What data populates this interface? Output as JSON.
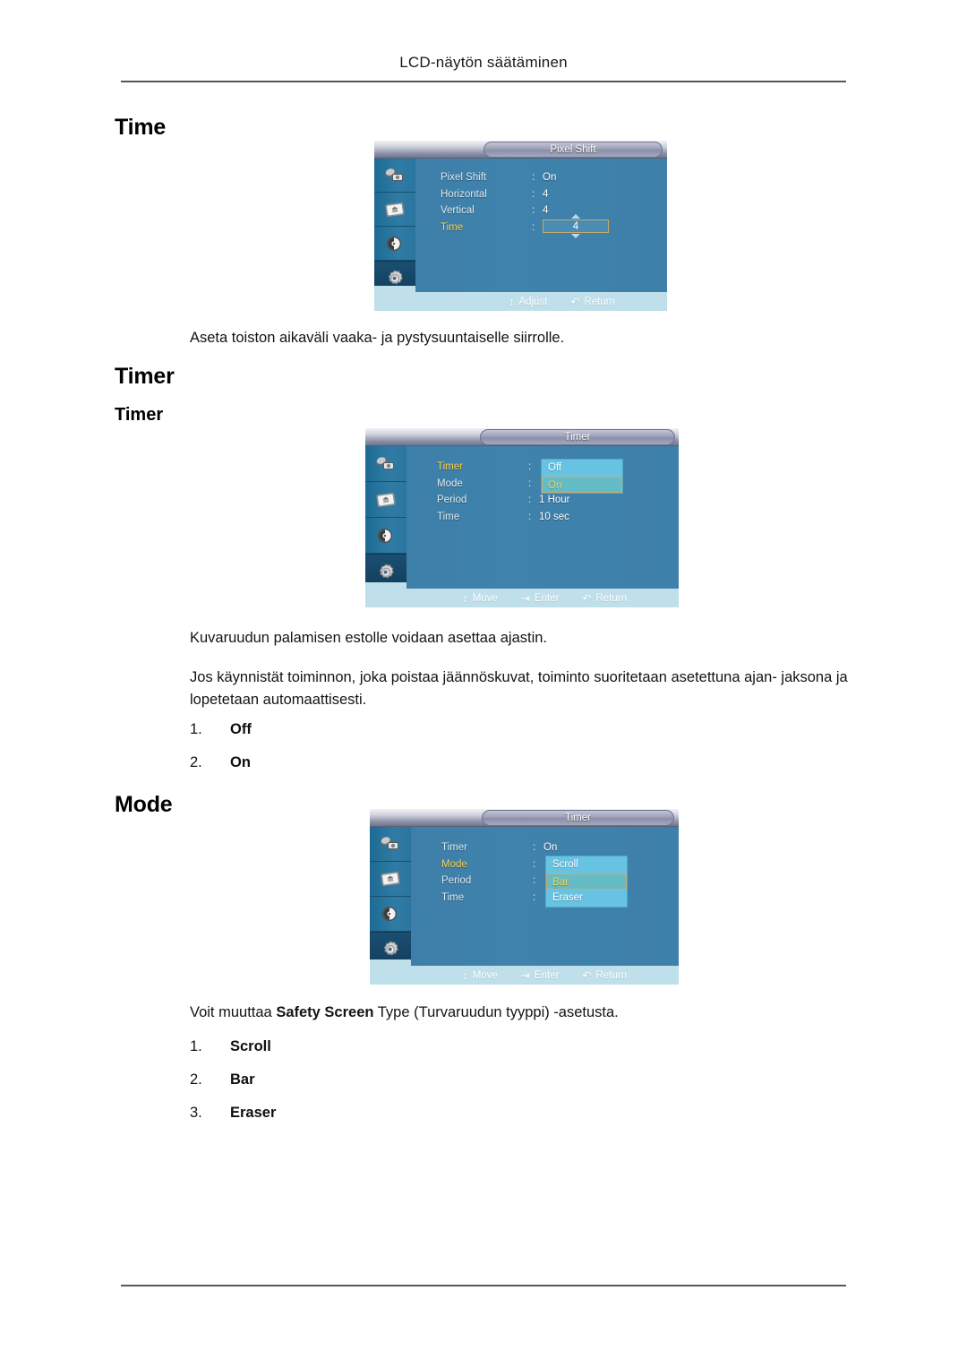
{
  "page": {
    "header_title": "LCD-näytön säätäminen"
  },
  "sections": [
    {
      "heading": "Time",
      "caption": "Aseta toiston aikaväli vaaka- ja pystysuuntaiselle siirrolle."
    },
    {
      "heading": "Timer",
      "subheading": "Timer",
      "caption1": "Kuvaruudun palamisen estolle voidaan asettaa ajastin.",
      "caption2_a": "Jos käynnistät toiminnon, joka poistaa jäännöskuvat, toiminto suoritetaan asetettuna ajan-",
      "caption2_b": "jaksona ja lopetetaan automaattisesti.",
      "options": [
        {
          "num": "1.",
          "label": "Off"
        },
        {
          "num": "2.",
          "label": "On"
        }
      ]
    },
    {
      "heading": "Mode",
      "caption_pre": "Voit muuttaa ",
      "caption_bold": "Safety Screen",
      "caption_post": " Type (Turvaruudun tyyppi) -asetusta.",
      "options": [
        {
          "num": "1.",
          "label": "Scroll"
        },
        {
          "num": "2.",
          "label": "Bar"
        },
        {
          "num": "3.",
          "label": "Eraser"
        }
      ]
    }
  ],
  "osd": [
    {
      "id": "pixel-shift",
      "title": "Pixel Shift",
      "sidebar_icons": [
        "input-source-icon",
        "picture-icon",
        "sound-icon",
        "setup-gear-icon",
        "multi-control-icon"
      ],
      "active_icon_index": 3,
      "rows": [
        {
          "label": "Pixel Shift",
          "value": "On",
          "highlight": false
        },
        {
          "label": "Horizontal",
          "value": "4",
          "highlight": false
        },
        {
          "label": "Vertical",
          "value": "4",
          "highlight": false
        },
        {
          "label": "Time",
          "value": "4",
          "highlight": true,
          "spinner": true
        }
      ],
      "footer": [
        {
          "icon": "updown-arrow-icon",
          "label": "Adjust"
        },
        {
          "icon": "return-arrow-icon",
          "label": "Return"
        }
      ]
    },
    {
      "id": "timer-menu",
      "title": "Timer",
      "sidebar_icons": [
        "input-source-icon",
        "picture-icon",
        "sound-icon",
        "setup-gear-icon",
        "multi-control-icon"
      ],
      "active_icon_index": 3,
      "rows": [
        {
          "label": "Timer",
          "value": "",
          "highlight": true
        },
        {
          "label": "Mode",
          "value": "",
          "highlight": false
        },
        {
          "label": "Period",
          "value": "1 Hour",
          "highlight": false
        },
        {
          "label": "Time",
          "value": "10 sec",
          "highlight": false
        }
      ],
      "dropdown": {
        "options": [
          "Off",
          "On"
        ],
        "selected": "On"
      },
      "footer": [
        {
          "icon": "updown-arrow-icon",
          "label": "Move"
        },
        {
          "icon": "enter-icon",
          "label": "Enter"
        },
        {
          "icon": "return-arrow-icon",
          "label": "Return"
        }
      ]
    },
    {
      "id": "mode-menu",
      "title": "Timer",
      "sidebar_icons": [
        "input-source-icon",
        "picture-icon",
        "sound-icon",
        "setup-gear-icon",
        "multi-control-icon"
      ],
      "active_icon_index": 3,
      "rows": [
        {
          "label": "Timer",
          "value": "On",
          "highlight": false
        },
        {
          "label": "Mode",
          "value": "",
          "highlight": true
        },
        {
          "label": "Period",
          "value": "",
          "highlight": false
        },
        {
          "label": "Time",
          "value": "",
          "highlight": false
        }
      ],
      "dropdown": {
        "options": [
          "Scroll",
          "Bar",
          "Eraser"
        ],
        "selected": "Bar"
      },
      "footer": [
        {
          "icon": "updown-arrow-icon",
          "label": "Move"
        },
        {
          "icon": "enter-icon",
          "label": "Enter"
        },
        {
          "icon": "return-arrow-icon",
          "label": "Return"
        }
      ]
    }
  ],
  "colors": {
    "osd_background": "#3f82ac",
    "osd_sidebar": "#2a76a0",
    "osd_footer": "#bfdfea",
    "highlight_text": "#ffd24a",
    "dropdown_background": "#68c3e2",
    "dropdown_selected": "#63bcc6",
    "selection_border": "#c9ad72"
  }
}
